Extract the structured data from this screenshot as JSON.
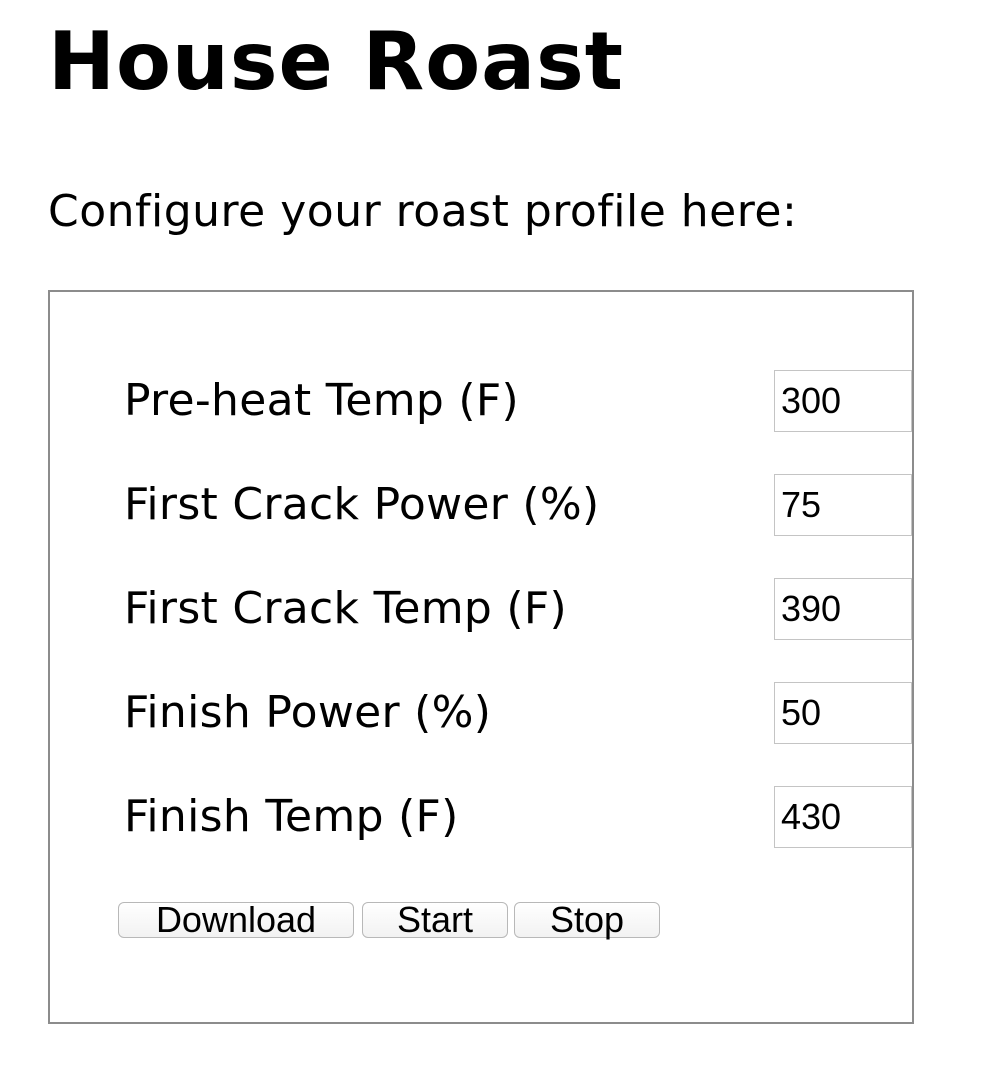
{
  "header": {
    "title": "House Roast",
    "intro": "Configure your roast profile here:"
  },
  "form": {
    "fields": [
      {
        "label": "Pre-heat Temp (F)",
        "value": "300"
      },
      {
        "label": "First Crack Power (%)",
        "value": "75"
      },
      {
        "label": "First Crack Temp (F)",
        "value": "390"
      },
      {
        "label": "Finish Power (%)",
        "value": "50"
      },
      {
        "label": "Finish Temp (F)",
        "value": "430"
      }
    ],
    "buttons": {
      "download": "Download",
      "start": "Start",
      "stop": "Stop"
    }
  }
}
